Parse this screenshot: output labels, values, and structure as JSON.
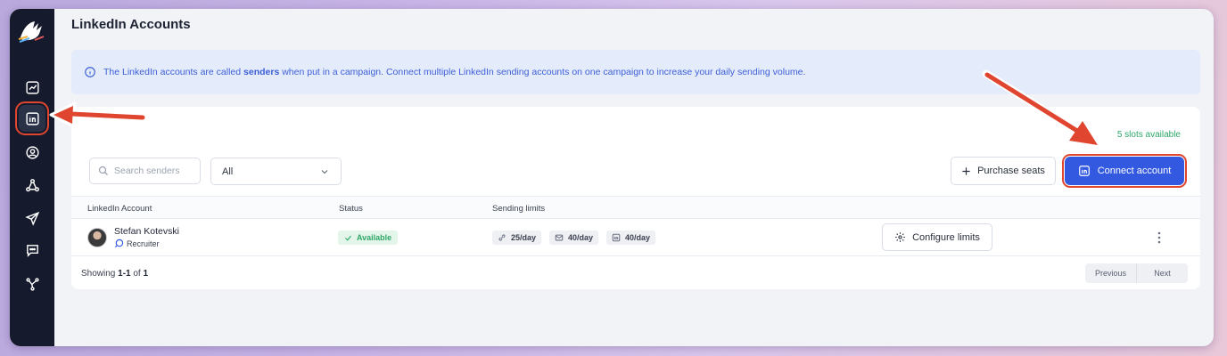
{
  "page": {
    "title": "LinkedIn Accounts"
  },
  "banner": {
    "text_before": "The LinkedIn accounts are called ",
    "highlight": "senders",
    "text_after": " when put in a campaign. Connect multiple LinkedIn sending accounts on one campaign to increase your daily sending volume."
  },
  "sidebar": {
    "items": [
      {
        "icon": "chart-icon"
      },
      {
        "icon": "linkedin-icon",
        "active": true
      },
      {
        "icon": "user-circle-icon"
      },
      {
        "icon": "network-icon"
      },
      {
        "icon": "send-icon"
      },
      {
        "icon": "chat-icon"
      },
      {
        "icon": "flow-icon"
      }
    ]
  },
  "toolbar": {
    "slots": "5 slots available",
    "search_placeholder": "Search senders",
    "filter_value": "All",
    "purchase_label": "Purchase seats",
    "connect_label": "Connect account"
  },
  "table": {
    "headers": [
      "LinkedIn Account",
      "Status",
      "Sending limits"
    ],
    "rows": [
      {
        "name": "Stefan Kotevski",
        "role": "Recruiter",
        "status": "Available",
        "limits": [
          "25/day",
          "40/day",
          "40/day"
        ],
        "configure_label": "Configure limits"
      }
    ]
  },
  "footer": {
    "showing_prefix": "Showing ",
    "showing_range": "1-1",
    "showing_of": " of ",
    "showing_total": "1",
    "prev_label": "Previous",
    "next_label": "Next"
  },
  "colors": {
    "accent": "#3359e0",
    "annotation": "#e0462f",
    "success": "#2fa76a",
    "sidebar_bg": "#151a2c"
  }
}
